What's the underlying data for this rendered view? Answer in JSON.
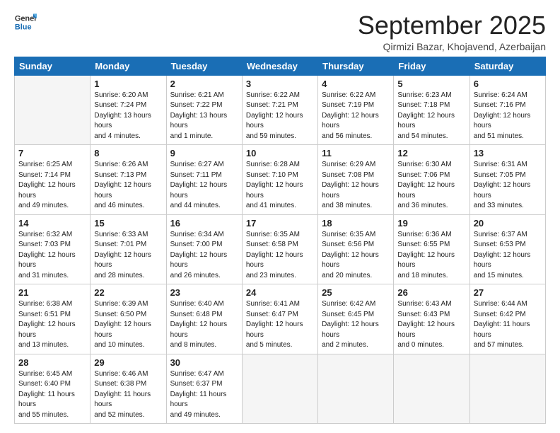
{
  "header": {
    "logo_general": "General",
    "logo_blue": "Blue",
    "month_title": "September 2025",
    "location": "Qirmizi Bazar, Khojavend, Azerbaijan"
  },
  "weekdays": [
    "Sunday",
    "Monday",
    "Tuesday",
    "Wednesday",
    "Thursday",
    "Friday",
    "Saturday"
  ],
  "weeks": [
    [
      {
        "day": "",
        "sunrise": "",
        "sunset": "",
        "daylight": ""
      },
      {
        "day": "1",
        "sunrise": "6:20 AM",
        "sunset": "7:24 PM",
        "daylight": "13 hours and 4 minutes."
      },
      {
        "day": "2",
        "sunrise": "6:21 AM",
        "sunset": "7:22 PM",
        "daylight": "13 hours and 1 minute."
      },
      {
        "day": "3",
        "sunrise": "6:22 AM",
        "sunset": "7:21 PM",
        "daylight": "12 hours and 59 minutes."
      },
      {
        "day": "4",
        "sunrise": "6:22 AM",
        "sunset": "7:19 PM",
        "daylight": "12 hours and 56 minutes."
      },
      {
        "day": "5",
        "sunrise": "6:23 AM",
        "sunset": "7:18 PM",
        "daylight": "12 hours and 54 minutes."
      },
      {
        "day": "6",
        "sunrise": "6:24 AM",
        "sunset": "7:16 PM",
        "daylight": "12 hours and 51 minutes."
      }
    ],
    [
      {
        "day": "7",
        "sunrise": "6:25 AM",
        "sunset": "7:14 PM",
        "daylight": "12 hours and 49 minutes."
      },
      {
        "day": "8",
        "sunrise": "6:26 AM",
        "sunset": "7:13 PM",
        "daylight": "12 hours and 46 minutes."
      },
      {
        "day": "9",
        "sunrise": "6:27 AM",
        "sunset": "7:11 PM",
        "daylight": "12 hours and 44 minutes."
      },
      {
        "day": "10",
        "sunrise": "6:28 AM",
        "sunset": "7:10 PM",
        "daylight": "12 hours and 41 minutes."
      },
      {
        "day": "11",
        "sunrise": "6:29 AM",
        "sunset": "7:08 PM",
        "daylight": "12 hours and 38 minutes."
      },
      {
        "day": "12",
        "sunrise": "6:30 AM",
        "sunset": "7:06 PM",
        "daylight": "12 hours and 36 minutes."
      },
      {
        "day": "13",
        "sunrise": "6:31 AM",
        "sunset": "7:05 PM",
        "daylight": "12 hours and 33 minutes."
      }
    ],
    [
      {
        "day": "14",
        "sunrise": "6:32 AM",
        "sunset": "7:03 PM",
        "daylight": "12 hours and 31 minutes."
      },
      {
        "day": "15",
        "sunrise": "6:33 AM",
        "sunset": "7:01 PM",
        "daylight": "12 hours and 28 minutes."
      },
      {
        "day": "16",
        "sunrise": "6:34 AM",
        "sunset": "7:00 PM",
        "daylight": "12 hours and 26 minutes."
      },
      {
        "day": "17",
        "sunrise": "6:35 AM",
        "sunset": "6:58 PM",
        "daylight": "12 hours and 23 minutes."
      },
      {
        "day": "18",
        "sunrise": "6:35 AM",
        "sunset": "6:56 PM",
        "daylight": "12 hours and 20 minutes."
      },
      {
        "day": "19",
        "sunrise": "6:36 AM",
        "sunset": "6:55 PM",
        "daylight": "12 hours and 18 minutes."
      },
      {
        "day": "20",
        "sunrise": "6:37 AM",
        "sunset": "6:53 PM",
        "daylight": "12 hours and 15 minutes."
      }
    ],
    [
      {
        "day": "21",
        "sunrise": "6:38 AM",
        "sunset": "6:51 PM",
        "daylight": "12 hours and 13 minutes."
      },
      {
        "day": "22",
        "sunrise": "6:39 AM",
        "sunset": "6:50 PM",
        "daylight": "12 hours and 10 minutes."
      },
      {
        "day": "23",
        "sunrise": "6:40 AM",
        "sunset": "6:48 PM",
        "daylight": "12 hours and 8 minutes."
      },
      {
        "day": "24",
        "sunrise": "6:41 AM",
        "sunset": "6:47 PM",
        "daylight": "12 hours and 5 minutes."
      },
      {
        "day": "25",
        "sunrise": "6:42 AM",
        "sunset": "6:45 PM",
        "daylight": "12 hours and 2 minutes."
      },
      {
        "day": "26",
        "sunrise": "6:43 AM",
        "sunset": "6:43 PM",
        "daylight": "12 hours and 0 minutes."
      },
      {
        "day": "27",
        "sunrise": "6:44 AM",
        "sunset": "6:42 PM",
        "daylight": "11 hours and 57 minutes."
      }
    ],
    [
      {
        "day": "28",
        "sunrise": "6:45 AM",
        "sunset": "6:40 PM",
        "daylight": "11 hours and 55 minutes."
      },
      {
        "day": "29",
        "sunrise": "6:46 AM",
        "sunset": "6:38 PM",
        "daylight": "11 hours and 52 minutes."
      },
      {
        "day": "30",
        "sunrise": "6:47 AM",
        "sunset": "6:37 PM",
        "daylight": "11 hours and 49 minutes."
      },
      {
        "day": "",
        "sunrise": "",
        "sunset": "",
        "daylight": ""
      },
      {
        "day": "",
        "sunrise": "",
        "sunset": "",
        "daylight": ""
      },
      {
        "day": "",
        "sunrise": "",
        "sunset": "",
        "daylight": ""
      },
      {
        "day": "",
        "sunrise": "",
        "sunset": "",
        "daylight": ""
      }
    ]
  ],
  "labels": {
    "sunrise": "Sunrise:",
    "sunset": "Sunset:",
    "daylight": "Daylight:"
  }
}
